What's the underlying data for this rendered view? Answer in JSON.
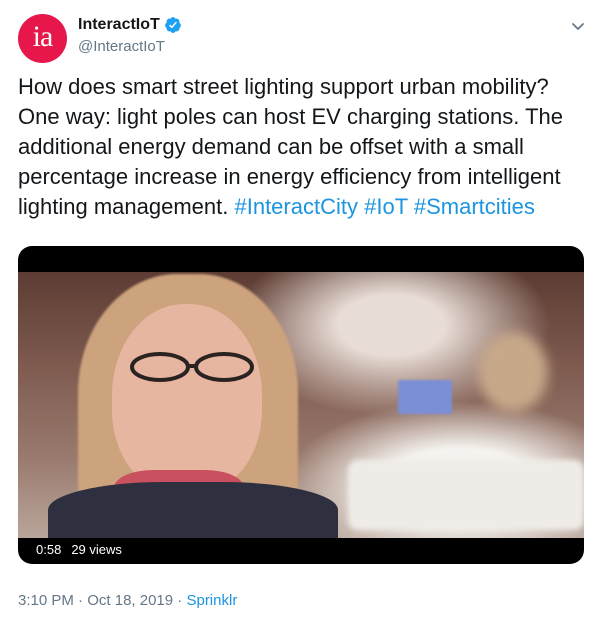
{
  "author": {
    "display_name": "InteractIoT",
    "handle": "@InteractIoT",
    "avatar_text": "ia",
    "avatar_color": "#e8174b",
    "verified": true
  },
  "tweet": {
    "text": "How does smart street lighting support urban mobility? One way: light poles can host EV charging stations. The additional energy demand can be offset with a small percentage increase in energy efficiency from intelligent lighting management.",
    "hashtags": [
      "#InteractCity",
      "#IoT",
      "#Smartcities"
    ],
    "link_color": "#1b95e0"
  },
  "media": {
    "duration": "0:58",
    "views": "29 views"
  },
  "meta": {
    "time": "3:10 PM",
    "date": "Oct 18, 2019",
    "separator": "·",
    "source": "Sprinklr"
  },
  "icons": {
    "verified": "verified-badge-icon",
    "more": "chevron-down-icon"
  }
}
